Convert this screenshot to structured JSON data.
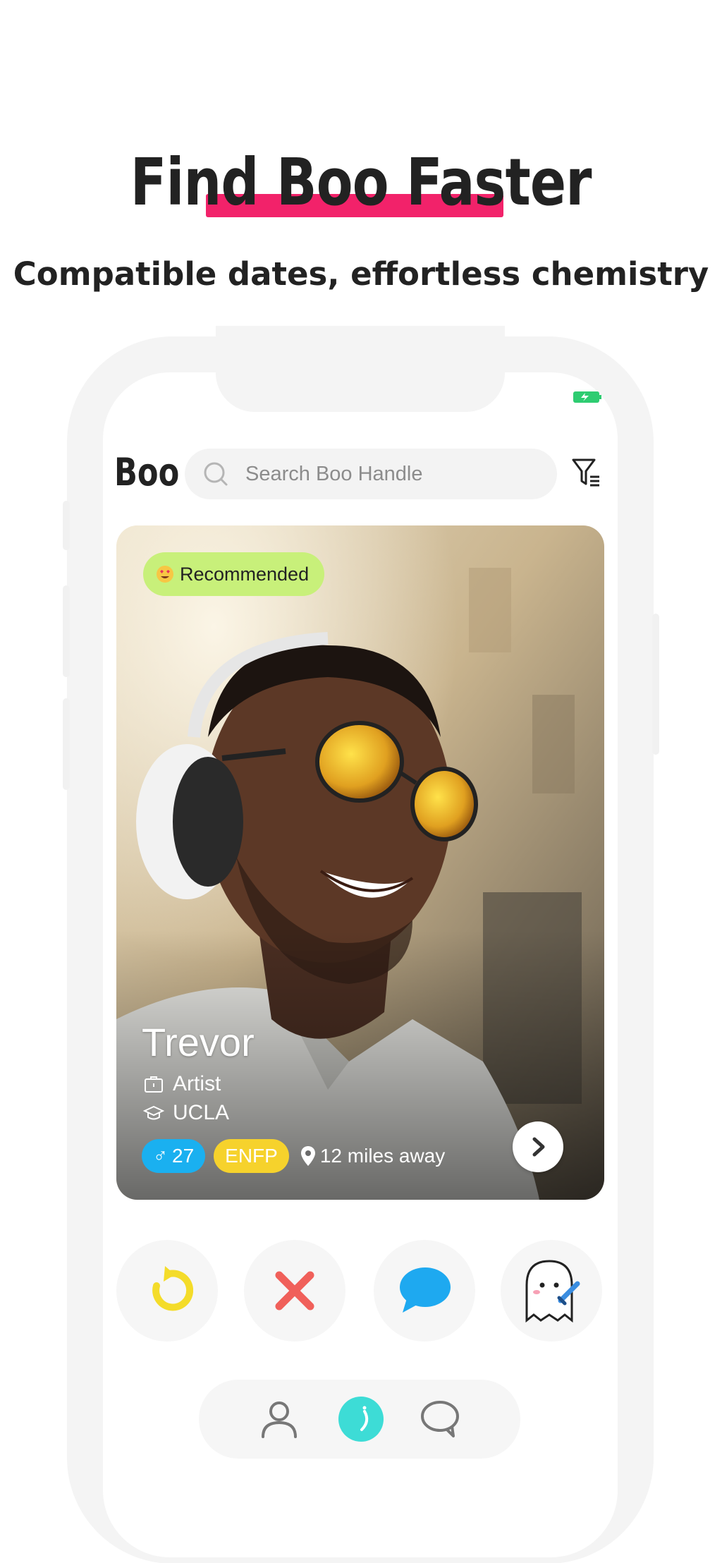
{
  "promo": {
    "headline": "Find Boo Faster",
    "subtitle": "Compatible dates, effortless chemistry"
  },
  "app": {
    "logo": "Boo",
    "search": {
      "placeholder": "Search Boo Handle",
      "value": ""
    }
  },
  "profile": {
    "badge": "Recommended",
    "name": "Trevor",
    "occupation": "Artist",
    "school": "UCLA",
    "gender_symbol": "♂",
    "age": "27",
    "mbti": "ENFP",
    "distance": "12 miles away"
  },
  "actions": [
    {
      "name": "rewind",
      "icon": "undo-arrow-icon",
      "color": "#f4dc2a"
    },
    {
      "name": "pass",
      "icon": "x-icon",
      "color": "#f0605a"
    },
    {
      "name": "message",
      "icon": "chat-bubble-icon",
      "color": "#1ea9f0"
    },
    {
      "name": "super-like",
      "icon": "ghost-icon",
      "color": "#3a8de0"
    }
  ],
  "nav": [
    {
      "name": "profile",
      "icon": "person-icon"
    },
    {
      "name": "home",
      "icon": "boo-home-icon",
      "active": true,
      "color": "#3ddcd6"
    },
    {
      "name": "messages",
      "icon": "speech-bubble-icon"
    }
  ],
  "colors": {
    "accent_pink": "#f2226a",
    "badge_green": "#c8f07a",
    "age_blue": "#1ab0f0",
    "mbti_yellow": "#f6d22c",
    "battery_green": "#2ecc71"
  }
}
